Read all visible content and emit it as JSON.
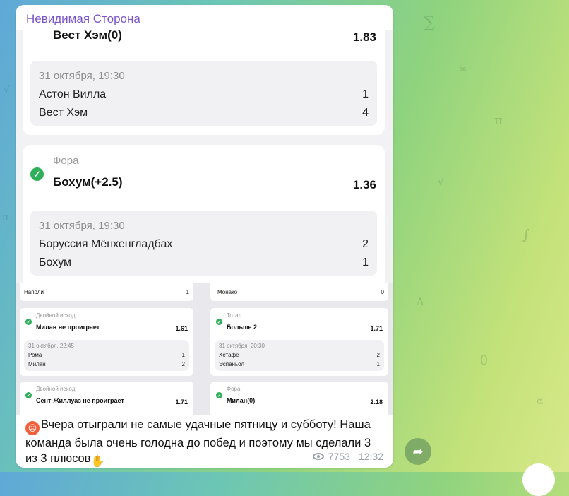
{
  "channel": {
    "name": "Невидимая Сторона"
  },
  "top_screenshot": {
    "partial_card": {
      "pick": "Вест Хэм(0)",
      "odds": "1.83"
    },
    "match1": {
      "date": "31 октября, 19:30",
      "teams": [
        {
          "name": "Астон Вилла",
          "score": "1"
        },
        {
          "name": "Вест Хэм",
          "score": "4"
        }
      ]
    },
    "card2": {
      "label": "Фора",
      "pick": "Бохум(+2.5)",
      "odds": "1.36",
      "date": "31 октября, 19:30",
      "teams": [
        {
          "name": "Боруссия Мёнхенгладбах",
          "score": "2"
        },
        {
          "name": "Бохум",
          "score": "1"
        }
      ]
    }
  },
  "bottom_screenshot": {
    "left": {
      "partial_row": {
        "name": "Наполи",
        "score": "1"
      },
      "card1": {
        "label": "Двойной исход",
        "pick": "Милан не проиграет",
        "odds": "1.61",
        "date": "31 октября, 22:45",
        "teams": [
          {
            "name": "Рома",
            "score": "1"
          },
          {
            "name": "Милан",
            "score": "2"
          }
        ]
      },
      "card2": {
        "label": "Двойной исход",
        "pick": "Сент-Жиллуаз не проиграет",
        "odds": "1.71"
      }
    },
    "right": {
      "partial_row": {
        "name": "Монако",
        "score": "0"
      },
      "card1": {
        "label": "Тотал",
        "pick": "Больше 2",
        "odds": "1.71",
        "date": "31 октября, 20:30",
        "teams": [
          {
            "name": "Хетафе",
            "score": "2"
          },
          {
            "name": "Эспаньол",
            "score": "1"
          }
        ]
      },
      "card2": {
        "label": "Фора",
        "pick": "Милан(0)",
        "odds": "2.18"
      }
    }
  },
  "caption": {
    "text": "Вчера отыграли не самые удачные пятницу и субботу! Наша команда была очень голодна до побед и поэтому мы сделали 3 из 3 плюсов"
  },
  "meta": {
    "views": "7753",
    "time": "12:32"
  },
  "colors": {
    "accent": "#7a56c9",
    "success": "#2eb05a"
  }
}
